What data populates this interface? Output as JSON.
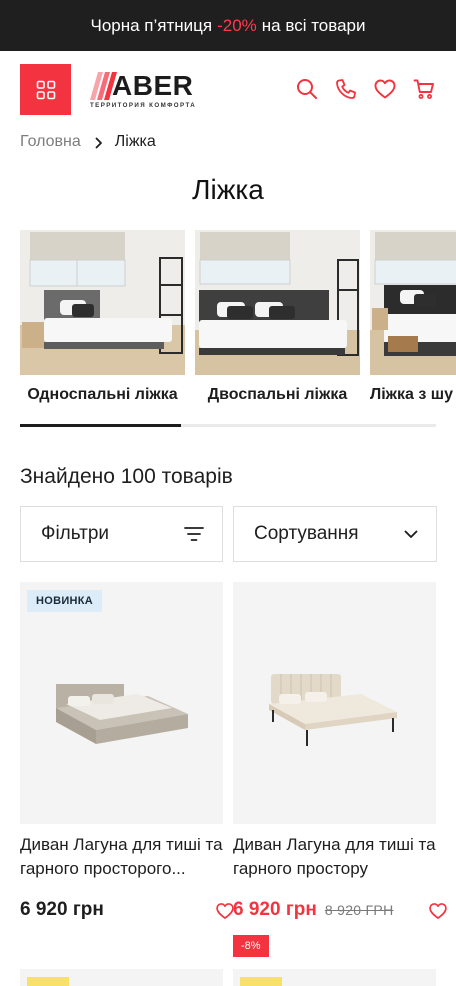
{
  "promo": {
    "text_before": "Чорна п’ятниця",
    "highlight": "-20%",
    "text_after": "на всі товари"
  },
  "logo": {
    "word": "ABER",
    "subtitle": "Территория комфорта"
  },
  "breadcrumb": {
    "home": "Головна",
    "current": "Ліжка"
  },
  "page_title": "Ліжка",
  "categories": [
    {
      "label": "Односпальні ліжка"
    },
    {
      "label": "Двоспальні ліжка"
    },
    {
      "label": "Ліжка з шу"
    }
  ],
  "found_text": "Знайдено 100 товарів",
  "controls": {
    "filters_label": "Фільтри",
    "sort_label": "Сортування"
  },
  "products": [
    {
      "badge": "НОВИНКА",
      "name": "Диван Лагуна для тиші та гарного просторого...",
      "price": "6 920 грн",
      "old_price": "",
      "discount": ""
    },
    {
      "badge": "",
      "name": "Диван Лагуна для тиші та гарного простору",
      "price": "6 920 грн",
      "old_price": "8 920 ГРН",
      "discount": "-8%"
    }
  ],
  "colors": {
    "accent": "#f3333f",
    "dark": "#1f1f1f",
    "badge_blue": "#dcecf9",
    "badge_yellow": "#f7e16b"
  }
}
